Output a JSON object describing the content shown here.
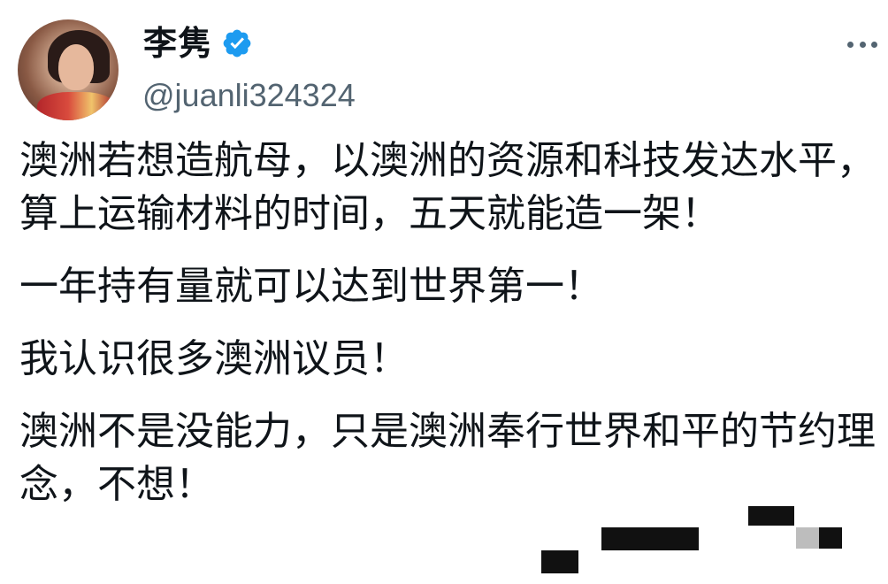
{
  "author": {
    "display_name": "李隽",
    "handle": "@juanli324324",
    "verified": true
  },
  "icons": {
    "verified": "verified-badge-icon",
    "more": "more-options-icon"
  },
  "colors": {
    "verified_blue": "#1d9bf0",
    "handle_gray": "#536471",
    "text": "#0f1419"
  },
  "post": {
    "lines": [
      "澳洲若想造航母，以澳洲的资源和科技发达水平，算上运输材料的时间，五天就能造一架！",
      "一年持有量就可以达到世界第一！",
      "我认识很多澳洲议员！",
      "澳洲不是没能力，只是澳洲奉行世界和平的节约理念，不想！"
    ]
  }
}
